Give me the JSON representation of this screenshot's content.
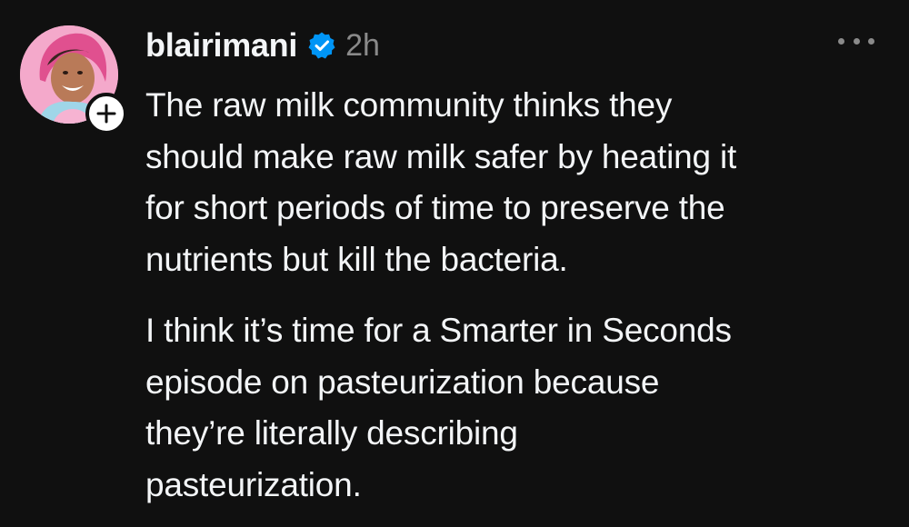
{
  "post": {
    "username": "blairimani",
    "timestamp": "2h",
    "verified": true,
    "paragraphs": [
      "The raw milk community thinks they\nshould make raw milk safer by heating it\nfor short periods of time to preserve the\nnutrients but kill the bacteria.",
      "I think it’s time for a Smarter in Seconds\nepisode on pasteurization because\nthey’re literally describing\npasteurization."
    ]
  },
  "icons": {
    "follow": "plus-icon",
    "verified": "verified-badge-icon",
    "more": "more-options-icon"
  },
  "colors": {
    "background": "#101010",
    "text": "#f3f5f7",
    "muted": "#8a8a8a",
    "verified": "#0095f6"
  }
}
